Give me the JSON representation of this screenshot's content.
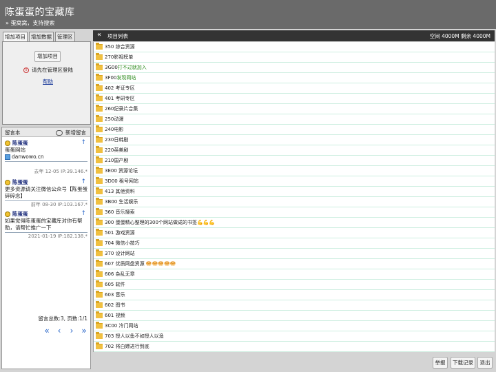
{
  "header": {
    "title": "陈蛋蛋的宝藏库",
    "subtitle": "» 蛋窝窝，支持搜索"
  },
  "tabs": [
    {
      "label": "增加项目",
      "active": true
    },
    {
      "label": "增加数据",
      "active": false
    },
    {
      "label": "管理区",
      "active": false
    }
  ],
  "panel": {
    "add_button": "增加项目",
    "warning": "请先在管理区登陆",
    "help": "帮助"
  },
  "messages": {
    "label": "留言本",
    "new_label": "新增留言",
    "items": [
      {
        "author": "陈蛋蛋",
        "body": "蛋蛋网站",
        "link": "danwowo.cn",
        "meta": "去年 12-05 IP:39.146.*"
      },
      {
        "author": "陈蛋蛋",
        "body": "更多资源请关注微信公众号【陈蛋蛋碎碎念】",
        "meta": "前年 08-30 IP:103.167.*"
      },
      {
        "author": "陈蛋蛋",
        "body": "如果觉得陈蛋蛋的宝藏库对你有帮助，请帮忙推广一下",
        "meta": "2021-01-19 IP:182.138.*"
      }
    ],
    "total": "留言总数:3, 页数:1/1",
    "pager": [
      "«",
      "‹",
      "›",
      "»"
    ]
  },
  "list": {
    "collapse_icon": "«",
    "label": "项目列表",
    "space": "空间 4000M   剩余 4000M",
    "rows": [
      {
        "text": "350 综合资源"
      },
      {
        "text": "270影视榜单"
      },
      {
        "text": "3G00 ",
        "green": "打不过就加入"
      },
      {
        "text": "3F00 ",
        "green": "发现网站"
      },
      {
        "text": "402 考证专区"
      },
      {
        "text": "401 考研专区"
      },
      {
        "text": "260纪录片合集"
      },
      {
        "text": "250动漫"
      },
      {
        "text": "240电影"
      },
      {
        "text": "230日韩剧"
      },
      {
        "text": "220英美剧"
      },
      {
        "text": "210国产剧"
      },
      {
        "text": "3E00 资源论坛"
      },
      {
        "text": "3D00 租号网站"
      },
      {
        "text": "413 其他资料"
      },
      {
        "text": "3B00 生活娱乐"
      },
      {
        "text": "360 音乐搜索"
      },
      {
        "text": "300 蛋蛋精心整理的300个网站做成的书签💪💪💪"
      },
      {
        "text": "501 游戏资源"
      },
      {
        "text": "704 微信小技巧"
      },
      {
        "text": "370 设计网站"
      },
      {
        "text": "607 优质网盘资源  🥯🥯🥯🥯🥯"
      },
      {
        "text": "606 杂乱无章"
      },
      {
        "text": "605 软件"
      },
      {
        "text": "603 音乐"
      },
      {
        "text": "602 图书"
      },
      {
        "text": "601 视频"
      },
      {
        "text": "3C00 冷门网站"
      },
      {
        "text": "703 授人以鱼不如授人以渔"
      },
      {
        "text": "702 将白嫖进行到底"
      }
    ]
  },
  "footer": {
    "report": "举报",
    "download": "下载记录",
    "logout": "退出"
  }
}
